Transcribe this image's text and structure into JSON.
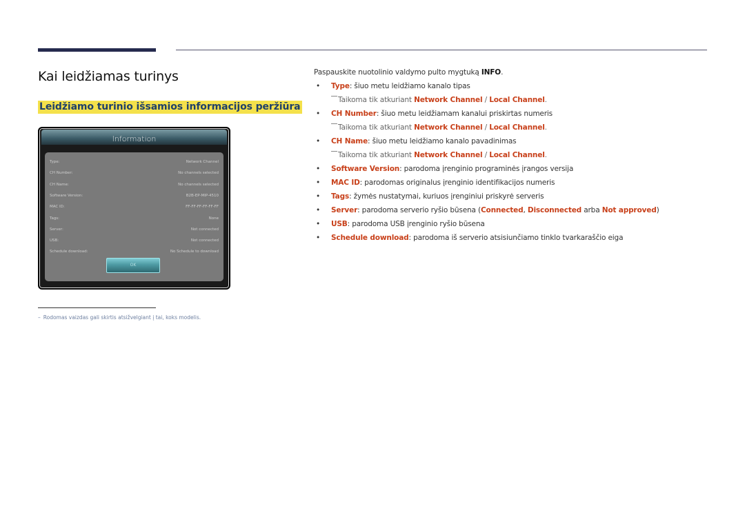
{
  "header": {
    "page_title": "Kai leidžiamas turinys",
    "section_title": "Leidžiamo turinio išsamios informacijos peržiūra"
  },
  "dialog": {
    "title": "Information",
    "rows": [
      {
        "label": "Type:",
        "value": "Network Channel"
      },
      {
        "label": "CH Number:",
        "value": "No channels selected"
      },
      {
        "label": "CH Name:",
        "value": "No channels selected"
      },
      {
        "label": "Software Version:",
        "value": "B2B-EP-MIP-4510"
      },
      {
        "label": "MAC ID:",
        "value": "FF-FF-FF-FF-FF-FF"
      },
      {
        "label": "Tags:",
        "value": "None"
      },
      {
        "label": "Server:",
        "value": "Not connected"
      },
      {
        "label": "USB:",
        "value": "Not connected"
      },
      {
        "label": "Schedule download:",
        "value": "No Schedule to download"
      }
    ],
    "ok_label": "OK"
  },
  "content": {
    "intro_text": "Paspauskite nuotolinio valdymo pulto mygtuką ",
    "intro_key": "INFO",
    "intro_end": ".",
    "note": {
      "prefix": "Taikoma tik atkuriant ",
      "term1": "Network Channel",
      "separator": " / ",
      "term2": "Local Channel",
      "suffix": "."
    },
    "bullets": [
      {
        "term": "Type",
        "text": ": šiuo metu leidžiamo kanalo tipas",
        "has_note": true
      },
      {
        "term": "CH Number",
        "text": ": šiuo metu leidžiamam kanalui priskirtas numeris",
        "has_note": true
      },
      {
        "term": "CH Name",
        "text": ": šiuo metu leidžiamo kanalo pavadinimas",
        "has_note": true
      },
      {
        "term": "Software Version",
        "text": ": parodoma įrenginio programinės įrangos versija"
      },
      {
        "term": "MAC ID",
        "text": ": parodomas originalus įrenginio identifikacijos numeris"
      },
      {
        "term": "Tags",
        "text": ": žymės nustatymai, kuriuos įrenginiui priskyrė serveris"
      },
      {
        "term": "Server",
        "text": ": parodoma serverio ryšio būsena (",
        "extra": [
          {
            "term": "Connected"
          },
          {
            "text": ", "
          },
          {
            "term": "Disconnected"
          },
          {
            "text": " arba "
          },
          {
            "term": "Not approved"
          },
          {
            "text": ")"
          }
        ]
      },
      {
        "term": "USB",
        "text": ": parodoma USB įrenginio ryšio būsena"
      },
      {
        "term": "Schedule download",
        "text": ": parodoma iš serverio atsisiunčiamo tinklo tvarkaraščio eiga"
      }
    ],
    "bullet_glyph": "•"
  },
  "footnote": {
    "dash": "–",
    "text": "Rodomas vaizdas gali skirtis atsižvelgiant į tai, koks modelis."
  },
  "colors": {
    "accent_term": "#c8401a",
    "section_highlight": "#f4e14b",
    "section_text": "#1f4069",
    "rule": "#252a4e"
  }
}
